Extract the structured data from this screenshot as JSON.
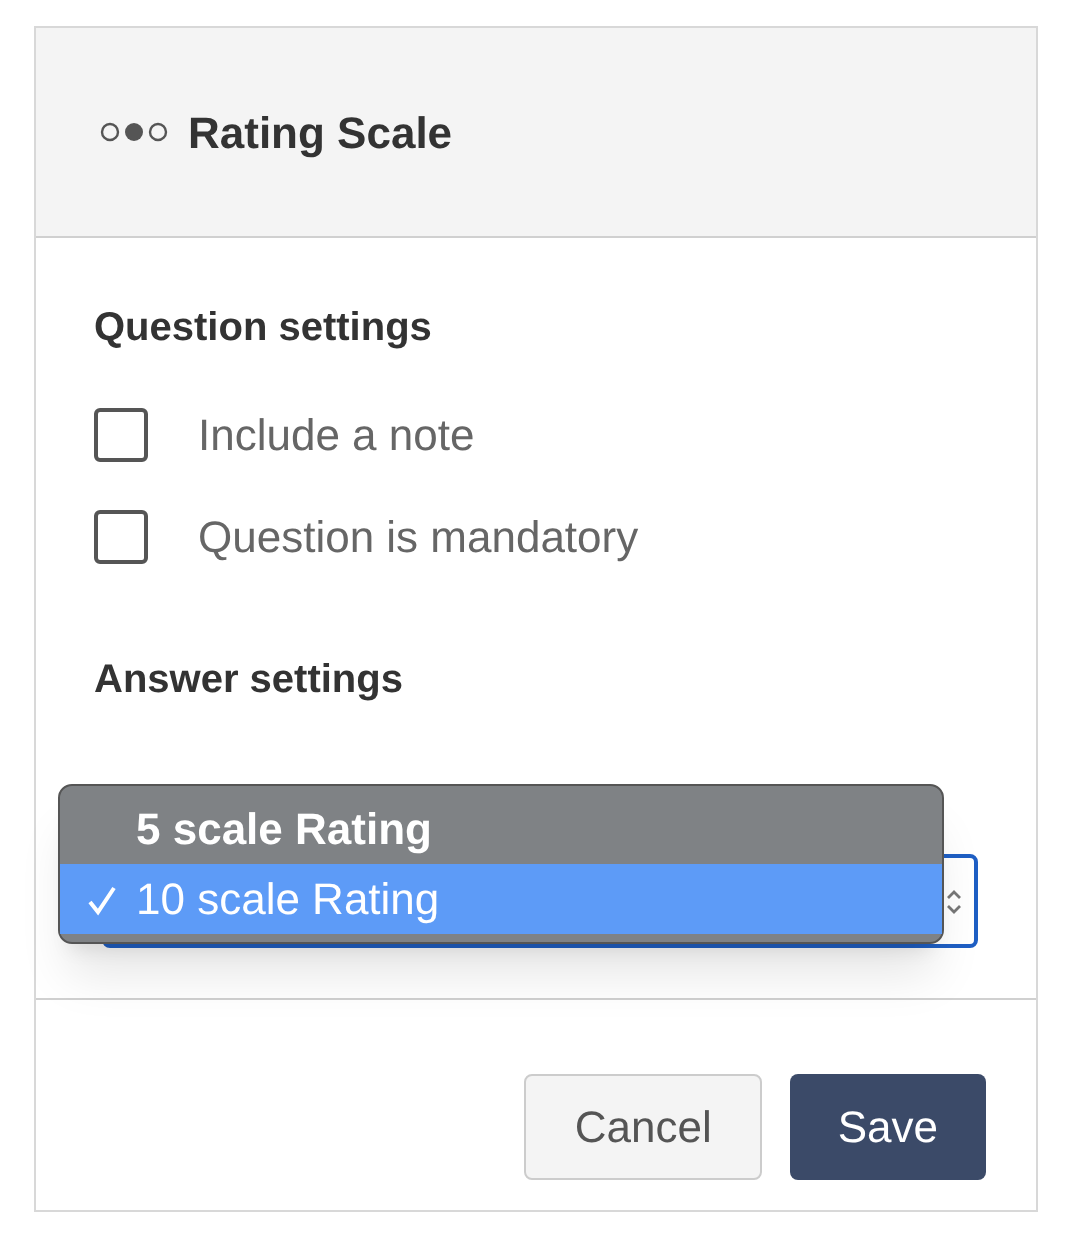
{
  "panel": {
    "title": "Rating Scale"
  },
  "question_settings": {
    "heading": "Question settings",
    "options": [
      {
        "label": "Include a note",
        "checked": false
      },
      {
        "label": "Question is mandatory",
        "checked": false
      }
    ]
  },
  "answer_settings": {
    "heading": "Answer settings",
    "dropdown": {
      "expanded": true,
      "options": [
        {
          "label": "5 scale Rating",
          "selected": false
        },
        {
          "label": "10 scale Rating",
          "selected": true
        }
      ]
    }
  },
  "buttons": [
    {
      "label": "Cancel",
      "kind": "secondary"
    },
    {
      "label": "Save",
      "kind": "primary"
    }
  ]
}
